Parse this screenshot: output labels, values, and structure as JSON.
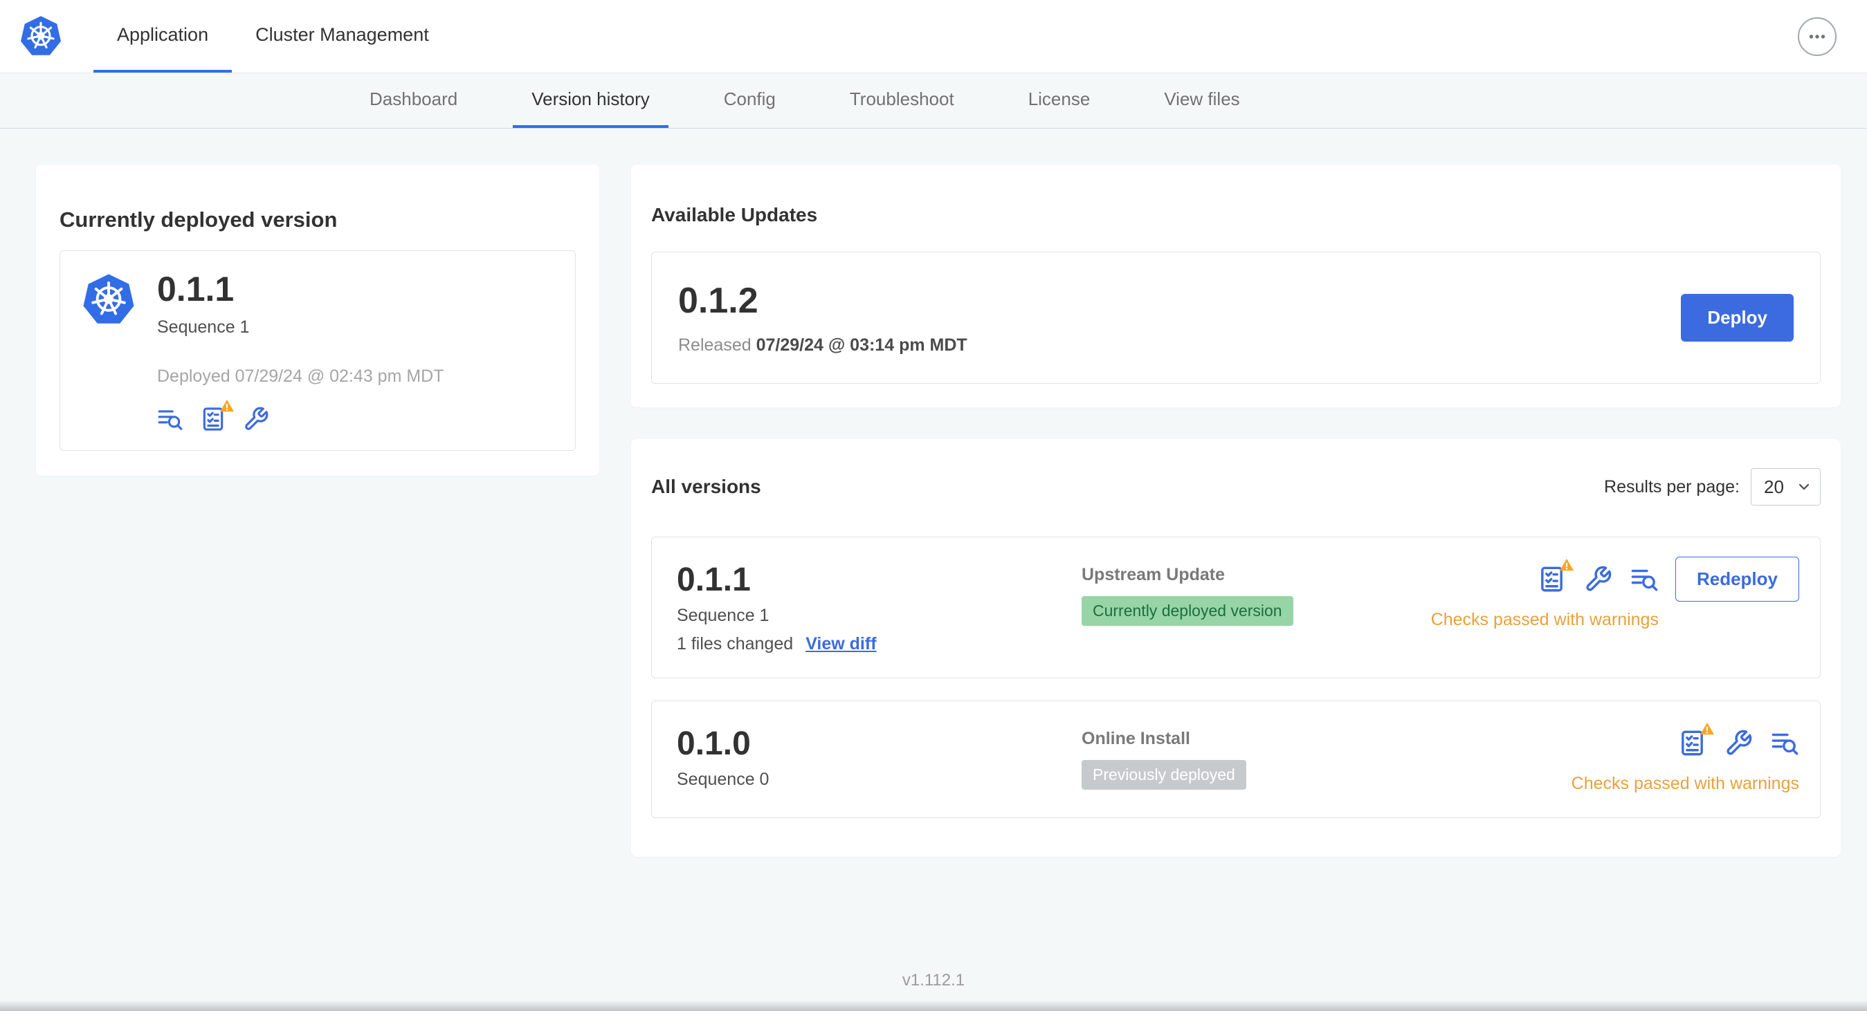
{
  "header": {
    "tabs": [
      {
        "label": "Application"
      },
      {
        "label": "Cluster Management"
      }
    ]
  },
  "subnav": {
    "tabs": [
      "Dashboard",
      "Version history",
      "Config",
      "Troubleshoot",
      "License",
      "View files"
    ],
    "active": "Version history"
  },
  "currently_deployed": {
    "title": "Currently deployed version",
    "version": "0.1.1",
    "sequence": "Sequence 1",
    "deployed_at": "Deployed 07/29/24 @ 02:43 pm MDT"
  },
  "available_updates": {
    "title": "Available Updates",
    "version": "0.1.2",
    "released_label": "Released",
    "released_at": "07/29/24 @ 03:14 pm MDT",
    "deploy_button": "Deploy"
  },
  "all_versions": {
    "title": "All versions",
    "results_per_page_label": "Results per page:",
    "results_per_page": "20",
    "rows": [
      {
        "version": "0.1.1",
        "sequence": "Sequence 1",
        "files_changed": "1 files changed",
        "view_diff_link": "View diff",
        "source": "Upstream Update",
        "badge": "Currently deployed version",
        "badge_type": "green",
        "status": "Checks passed with warnings",
        "redeploy_button": "Redeploy"
      },
      {
        "version": "0.1.0",
        "sequence": "Sequence 0",
        "source": "Online Install",
        "badge": "Previously deployed",
        "badge_type": "gray",
        "status": "Checks passed with warnings"
      }
    ]
  },
  "footer": {
    "app_version": "v1.112.1"
  },
  "icons": {
    "app_logo": "kubernetes-helm",
    "header_menu": "ellipsis",
    "release_notes": "text-lines-magnifier",
    "preflight_checks": "checklist",
    "config_values": "wrench",
    "warning_overlay": "orange-triangle-exclamation",
    "select_chevron": "chevron-down"
  },
  "colors": {
    "accent_blue": "#3b6bde",
    "kubernetes_blue": "#326de6",
    "warning_orange": "#e9a13b",
    "badge_green_bg": "#97d5a6",
    "badge_green_text": "#1c6e3f",
    "badge_gray_bg": "#c6cacc",
    "page_bg": "#f5f8f9"
  }
}
